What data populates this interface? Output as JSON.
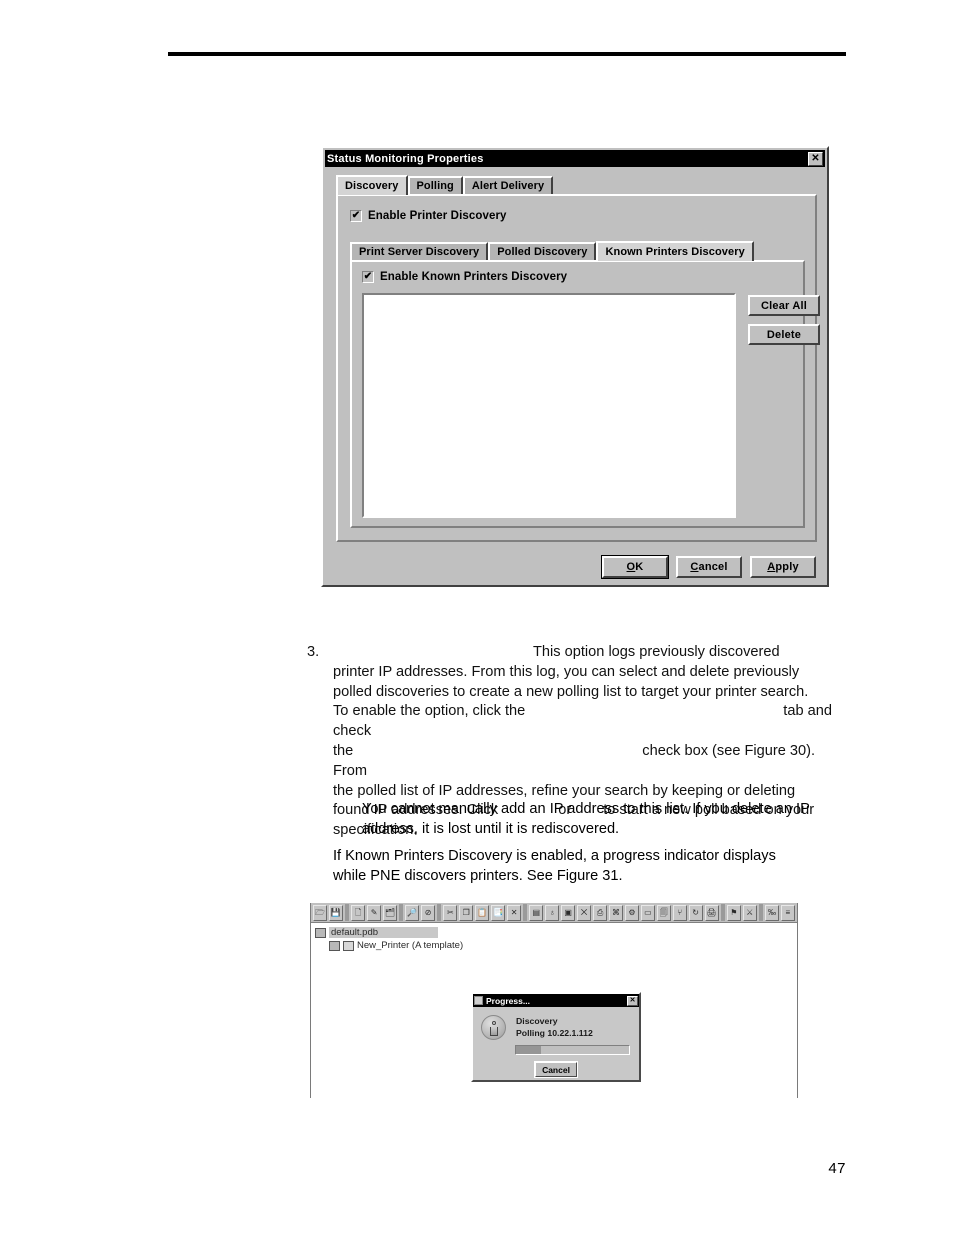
{
  "page": {
    "number": "47"
  },
  "figure_properties": {
    "window_title": "Status Monitoring Properties",
    "close_label": "✕",
    "outer_tabs": [
      {
        "label": "Discovery",
        "active": true
      },
      {
        "label": "Polling",
        "active": false
      },
      {
        "label": "Alert Delivery",
        "active": false
      }
    ],
    "enable_printer_discovery": {
      "label": "Enable Printer Discovery",
      "checked": true,
      "check_glyph": "✔"
    },
    "inner_tabs": [
      {
        "label": "Print Server Discovery",
        "active": false
      },
      {
        "label": "Polled Discovery",
        "active": false
      },
      {
        "label": "Known Printers Discovery",
        "active": true
      }
    ],
    "enable_known_printers_discovery": {
      "label": "Enable Known Printers Discovery",
      "checked": true,
      "check_glyph": "✔"
    },
    "list_items": [],
    "side_buttons": [
      {
        "label": "Clear All"
      },
      {
        "label": "Delete"
      }
    ],
    "footer_buttons": [
      {
        "label": "OK",
        "accel": "O",
        "default": true
      },
      {
        "label": "Cancel",
        "accel": "C",
        "default": false
      },
      {
        "label": "Apply",
        "accel": "A",
        "default": false
      }
    ]
  },
  "body": {
    "list_number": "3.",
    "step_line1_tail": "This option logs previously discovered",
    "step_line2": "printer IP addresses. From this log, you can select and delete previously",
    "step_line3": "polled discoveries to create a new polling list to target your printer search.",
    "step_line4_a": "To enable the option, click the",
    "step_line4_b": "tab and check",
    "step_line5_a": "the",
    "step_line5_b": "check box (see Figure 30). From",
    "step_line6": "the polled list of IP addresses, refine your search by keeping or deleting",
    "step_line7_a": "found IP addresses. Click",
    "step_line7_b": "or",
    "step_line7_c": "to start a new poll based on your",
    "step_line8": "specification.",
    "note_line1": "You cannot manually add an IP address to this list. If you delete an IP",
    "note_line2": "address, it is lost until it is rediscovered.",
    "after_line1": "If Known Printers Discovery is enabled, a progress indicator displays",
    "after_line2": "while PNE discovers printers. See Figure 31."
  },
  "figure_pne": {
    "toolbar_icons": [
      "open-folder-icon",
      "save-icon",
      "sep",
      "new-folder-icon",
      "edit-icon",
      "folder-properties-icon",
      "sep",
      "find-icon",
      "cancel-circle-icon",
      "sep",
      "cut-icon",
      "copy-icon",
      "paste-icon",
      "paste-special-icon",
      "delete-x-icon",
      "sep",
      "printer-panel-icon",
      "globe-icon",
      "network-card-icon",
      "xy-icon",
      "secure-printer-icon",
      "printer-alert-icon",
      "printer-config-icon",
      "display-icon",
      "clipboard-icon",
      "tree-icon",
      "refresh-icon",
      "printer-lock-icon",
      "sep",
      "flag-icon",
      "cross-tool-icon",
      "sep",
      "percent-icon",
      "status-icon"
    ],
    "tree": {
      "root_label": "default.pdb",
      "root_icon": "database-icon",
      "child_label": "New_Printer (A template)",
      "child_icon": "printer-icon",
      "child_doc_icon": "document-icon"
    },
    "progress_dialog": {
      "title": "Progress...",
      "title_icon": "java-coffee-icon",
      "close_label": "✕",
      "status_icon": "info-icon",
      "line1": "Discovery",
      "line2": "Polling 10.22.1.112",
      "progress_percent": 22,
      "cancel_label": "Cancel"
    }
  }
}
